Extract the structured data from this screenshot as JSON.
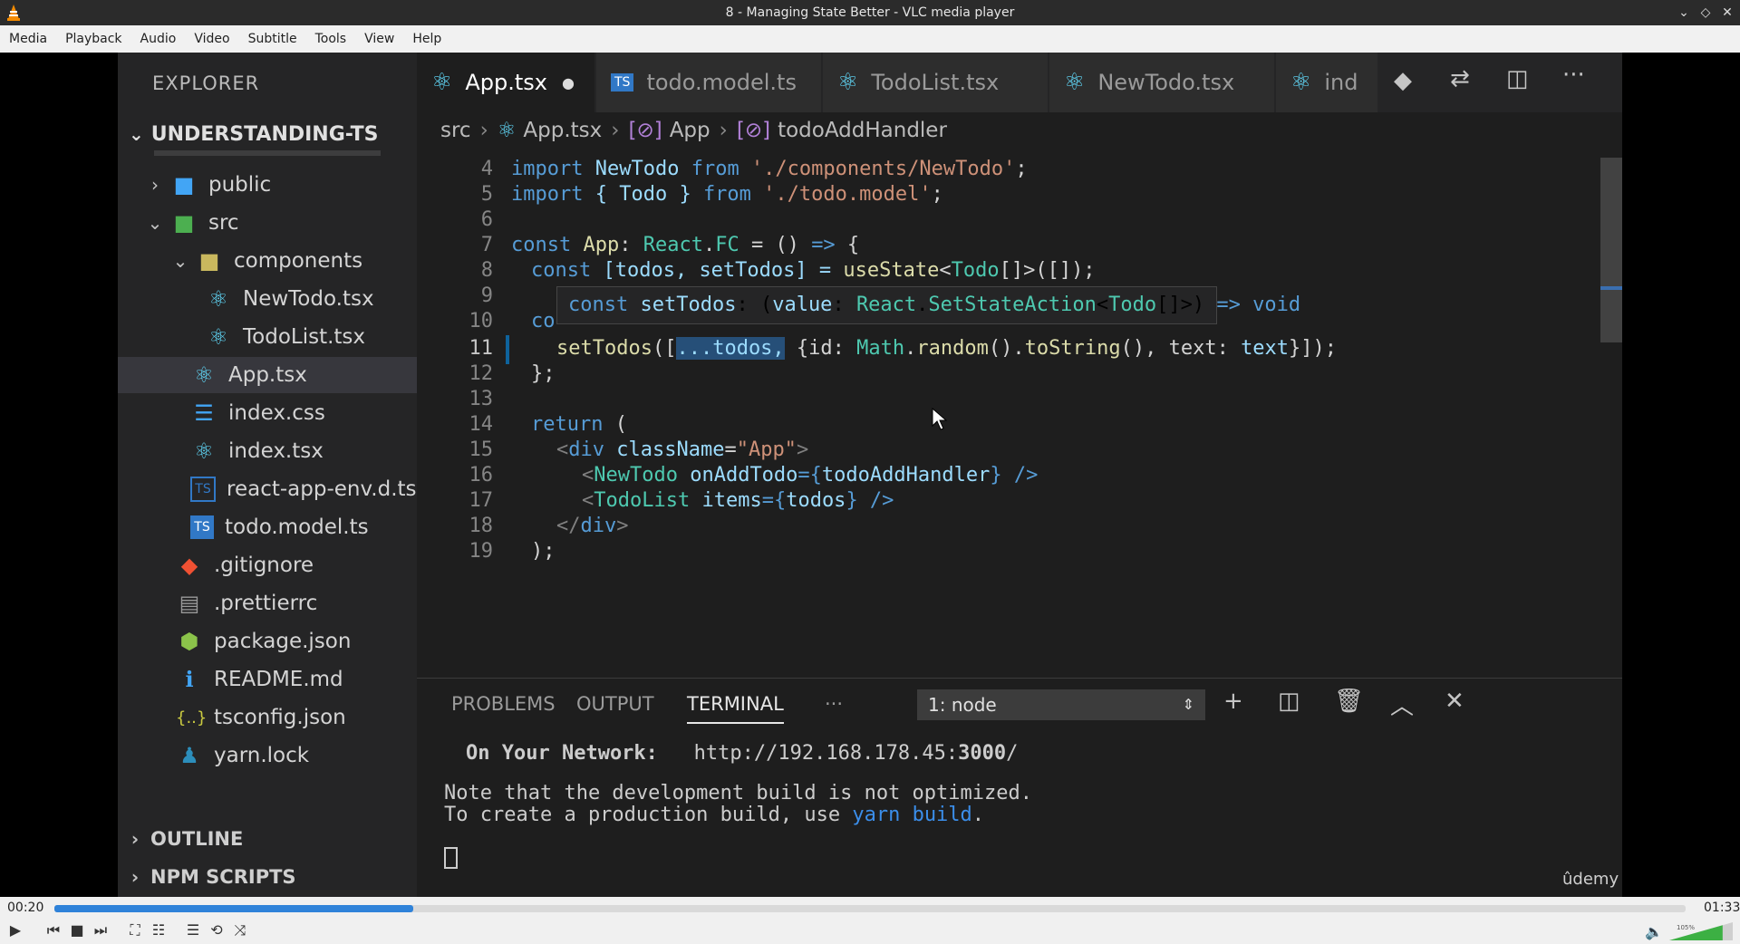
{
  "window": {
    "title": "8 - Managing State Better - VLC media player"
  },
  "menu": [
    "Media",
    "Playback",
    "Audio",
    "Video",
    "Subtitle",
    "Tools",
    "View",
    "Help"
  ],
  "sidebar": {
    "header": "EXPLORER",
    "project": "UNDERSTANDING-TS",
    "items": [
      {
        "label": "public"
      },
      {
        "label": "src"
      },
      {
        "label": "components"
      },
      {
        "label": "NewTodo.tsx"
      },
      {
        "label": "TodoList.tsx"
      },
      {
        "label": "App.tsx"
      },
      {
        "label": "index.css"
      },
      {
        "label": "index.tsx"
      },
      {
        "label": "react-app-env.d.ts"
      },
      {
        "label": "todo.model.ts"
      },
      {
        "label": ".gitignore"
      },
      {
        "label": ".prettierrc"
      },
      {
        "label": "package.json"
      },
      {
        "label": "README.md"
      },
      {
        "label": "tsconfig.json"
      },
      {
        "label": "yarn.lock"
      }
    ],
    "outline": "OUTLINE",
    "npm_scripts": "NPM SCRIPTS"
  },
  "tabs": [
    {
      "label": "App.tsx"
    },
    {
      "label": "todo.model.ts"
    },
    {
      "label": "TodoList.tsx"
    },
    {
      "label": "NewTodo.tsx"
    },
    {
      "label": "ind"
    }
  ],
  "breadcrumb": [
    "src",
    "App.tsx",
    "App",
    "todoAddHandler"
  ],
  "editor": {
    "line_numbers": [
      "4",
      "5",
      "6",
      "7",
      "8",
      "9",
      "10",
      "11",
      "12",
      "13",
      "14",
      "15",
      "16",
      "17",
      "18",
      "19"
    ],
    "hover": {
      "kw1": "const",
      "name": "setTodos",
      "p1": ": (",
      "param": "value",
      "p2": ": ",
      "t1": "React",
      "p3": ".",
      "t2": "SetStateAction",
      "p4": "<",
      "t3": "Todo",
      "p5": "[]>) ",
      "arrow": "=>",
      "ret": "void"
    },
    "lines": {
      "l4": {
        "a": "import",
        "b": " NewTodo ",
        "c": "from",
        "d": " './components/NewTodo'",
        "e": ";"
      },
      "l5": {
        "a": "import",
        "b": " { Todo } ",
        "c": "from",
        "d": " './todo.model'",
        "e": ";"
      },
      "l7": {
        "a": "const",
        "b": " App",
        "c": ": ",
        "d": "React",
        "e": ".",
        "f": "FC",
        "g": " = () ",
        "h": "=>",
        "i": " {"
      },
      "l8": {
        "a": "const",
        "b": " [todos, setTodos] = ",
        "c": "useState",
        "d": "<",
        "e": "Todo",
        "f": "[]>([]);"
      },
      "l10": {
        "a": "co"
      },
      "l11": {
        "a": "setTodos",
        "b": "([",
        "c": "...todos,",
        "d": " {id: ",
        "e": "Math",
        "f": ".",
        "g": "random",
        "h": "().",
        "i": "toString",
        "j": "(), text: ",
        "k": "text",
        "l": "}]);"
      },
      "l12": {
        "a": "};"
      },
      "l14": {
        "a": "return",
        "b": " ("
      },
      "l15": {
        "a": "<",
        "b": "div",
        "c": " className",
        "d": "=",
        "e": "\"App\"",
        "f": ">"
      },
      "l16": {
        "a": "<",
        "b": "NewTodo",
        "c": " onAddTodo",
        "d": "={",
        "e": "todoAddHandler",
        "f": "} />"
      },
      "l17": {
        "a": "<",
        "b": "TodoList",
        "c": " items",
        "d": "={",
        "e": "todos",
        "f": "} />"
      },
      "l18": {
        "a": "</",
        "b": "div",
        "c": ">"
      },
      "l19": {
        "a": ");"
      }
    }
  },
  "panel": {
    "tabs": [
      "PROBLEMS",
      "OUTPUT",
      "TERMINAL",
      "···"
    ],
    "terminal_select": "1: node",
    "terminal_lines": {
      "net_label": "On Your Network:",
      "net_url_a": "http://192.168.178.45:",
      "net_url_b": "3000",
      "net_url_c": "/",
      "note1": "Note that the development build is not optimized.",
      "note2a": "To create a production build, use ",
      "note2b": "yarn build",
      "note2c": "."
    },
    "watermark": "ûdemy"
  },
  "player": {
    "elapsed": "00:20",
    "total": "01:33",
    "progress": 0.22,
    "volume_label": "105%",
    "volume": 1.05
  }
}
